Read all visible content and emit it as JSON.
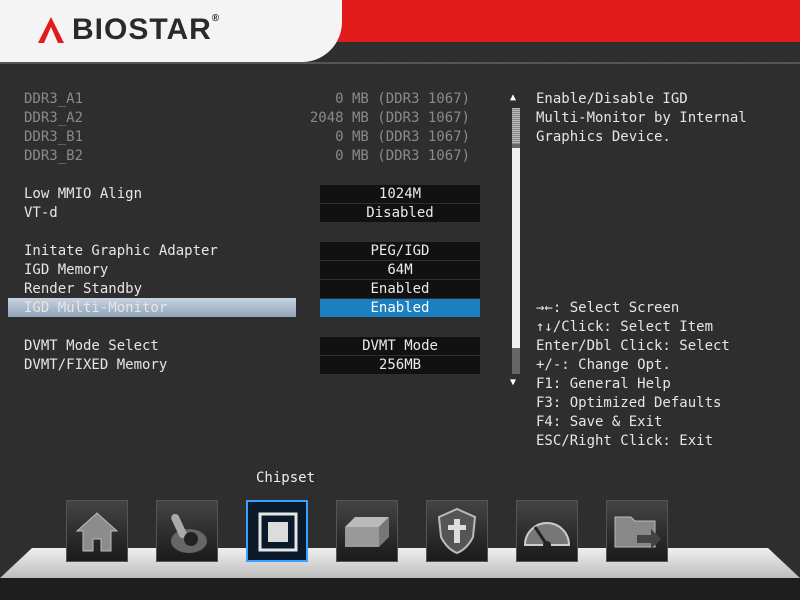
{
  "brand": {
    "name": "BIOSTAR",
    "reg": "®"
  },
  "memory": [
    {
      "label": "DDR3_A1",
      "value": "0 MB (DDR3 1067)"
    },
    {
      "label": "DDR3_A2",
      "value": "2048 MB (DDR3 1067)"
    },
    {
      "label": "DDR3_B1",
      "value": "0 MB (DDR3 1067)"
    },
    {
      "label": "DDR3_B2",
      "value": "0 MB (DDR3 1067)"
    }
  ],
  "settings": {
    "low_mmio": {
      "label": "Low MMIO Align",
      "value": "1024M"
    },
    "vtd": {
      "label": "VT-d",
      "value": "Disabled"
    },
    "init_graphic": {
      "label": "Initate Graphic Adapter",
      "value": "PEG/IGD"
    },
    "igd_memory": {
      "label": "IGD Memory",
      "value": "64M"
    },
    "render_standby": {
      "label": "Render Standby",
      "value": "Enabled"
    },
    "igd_multi": {
      "label": "IGD Multi-Monitor",
      "value": "Enabled"
    },
    "dvmt_mode": {
      "label": "DVMT Mode Select",
      "value": "DVMT Mode"
    },
    "dvmt_fixed": {
      "label": "DVMT/FIXED Memory",
      "value": "256MB"
    }
  },
  "scroll": {
    "up": "▲",
    "down": "▼"
  },
  "help": {
    "description": "Enable/Disable IGD\nMulti-Monitor by Internal\nGraphics Device.",
    "keys": [
      "→←: Select Screen",
      "↑↓/Click: Select Item",
      "Enter/Dbl Click: Select",
      "+/-: Change Opt.",
      "F1: General Help",
      "F3: Optimized Defaults",
      "F4: Save & Exit",
      "ESC/Right Click: Exit"
    ]
  },
  "nav": {
    "active_title": "Chipset",
    "items": [
      {
        "icon": "home-icon"
      },
      {
        "icon": "joystick-icon"
      },
      {
        "icon": "chipset-icon"
      },
      {
        "icon": "drive-icon"
      },
      {
        "icon": "shield-icon"
      },
      {
        "icon": "gauge-icon"
      },
      {
        "icon": "folder-exit-icon"
      }
    ]
  },
  "colors": {
    "accent": "#e11a1a",
    "selected": "#1c7fc0",
    "active_border": "#3aa0ff"
  }
}
